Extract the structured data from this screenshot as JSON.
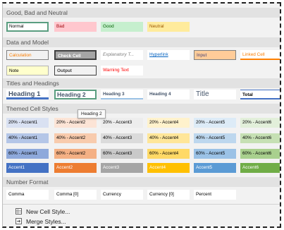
{
  "sections": {
    "good_bad_neutral": "Good, Bad and Neutral",
    "data_model": "Data and Model",
    "titles_headings": "Titles and Headings",
    "themed": "Themed Cell Styles",
    "number_format": "Number Format"
  },
  "good_bad": [
    "Normal",
    "Bad",
    "Good",
    "Neutral"
  ],
  "data_model": [
    "Calculation",
    "Check Cell",
    "Explanatory T...",
    "Hyperlink",
    "Input",
    "Linked Cell",
    "Note",
    "Output",
    "Warning Text"
  ],
  "titles": [
    "Heading 1",
    "Heading 2",
    "Heading 3",
    "Heading 4",
    "Title",
    "Total"
  ],
  "tooltip": "Heading 2",
  "themed": {
    "row20": [
      "20% - Accent1",
      "20% - Accent2",
      "20% - Accent3",
      "20% - Accent4",
      "20% - Accent5",
      "20% - Accent6"
    ],
    "row40": [
      "40% - Accent1",
      "40% - Accent2",
      "40% - Accent3",
      "40% - Accent4",
      "40% - Accent5",
      "40% - Accent6"
    ],
    "row60": [
      "60% - Accent1",
      "60% - Accent2",
      "60% - Accent3",
      "60% - Accent4",
      "60% - Accent5",
      "60% - Accent6"
    ],
    "accent": [
      "Accent1",
      "Accent2",
      "Accent3",
      "Accent4",
      "Accent5",
      "Accent6"
    ]
  },
  "number_format": [
    "Comma",
    "Comma [0]",
    "Currency",
    "Currency [0]",
    "Percent"
  ],
  "menu": {
    "new_style": "New Cell Style...",
    "merge_styles": "Merge Styles..."
  },
  "icons": {
    "new_style": "new-cell-style-icon",
    "merge_styles": "merge-styles-icon"
  },
  "colors": {
    "accent1": "#4472c4",
    "accent2": "#ed7d31",
    "accent3": "#a5a5a5",
    "accent4": "#ffc000",
    "accent5": "#5b9bd5",
    "accent6": "#70ad47",
    "selection": "#5a9e80"
  }
}
